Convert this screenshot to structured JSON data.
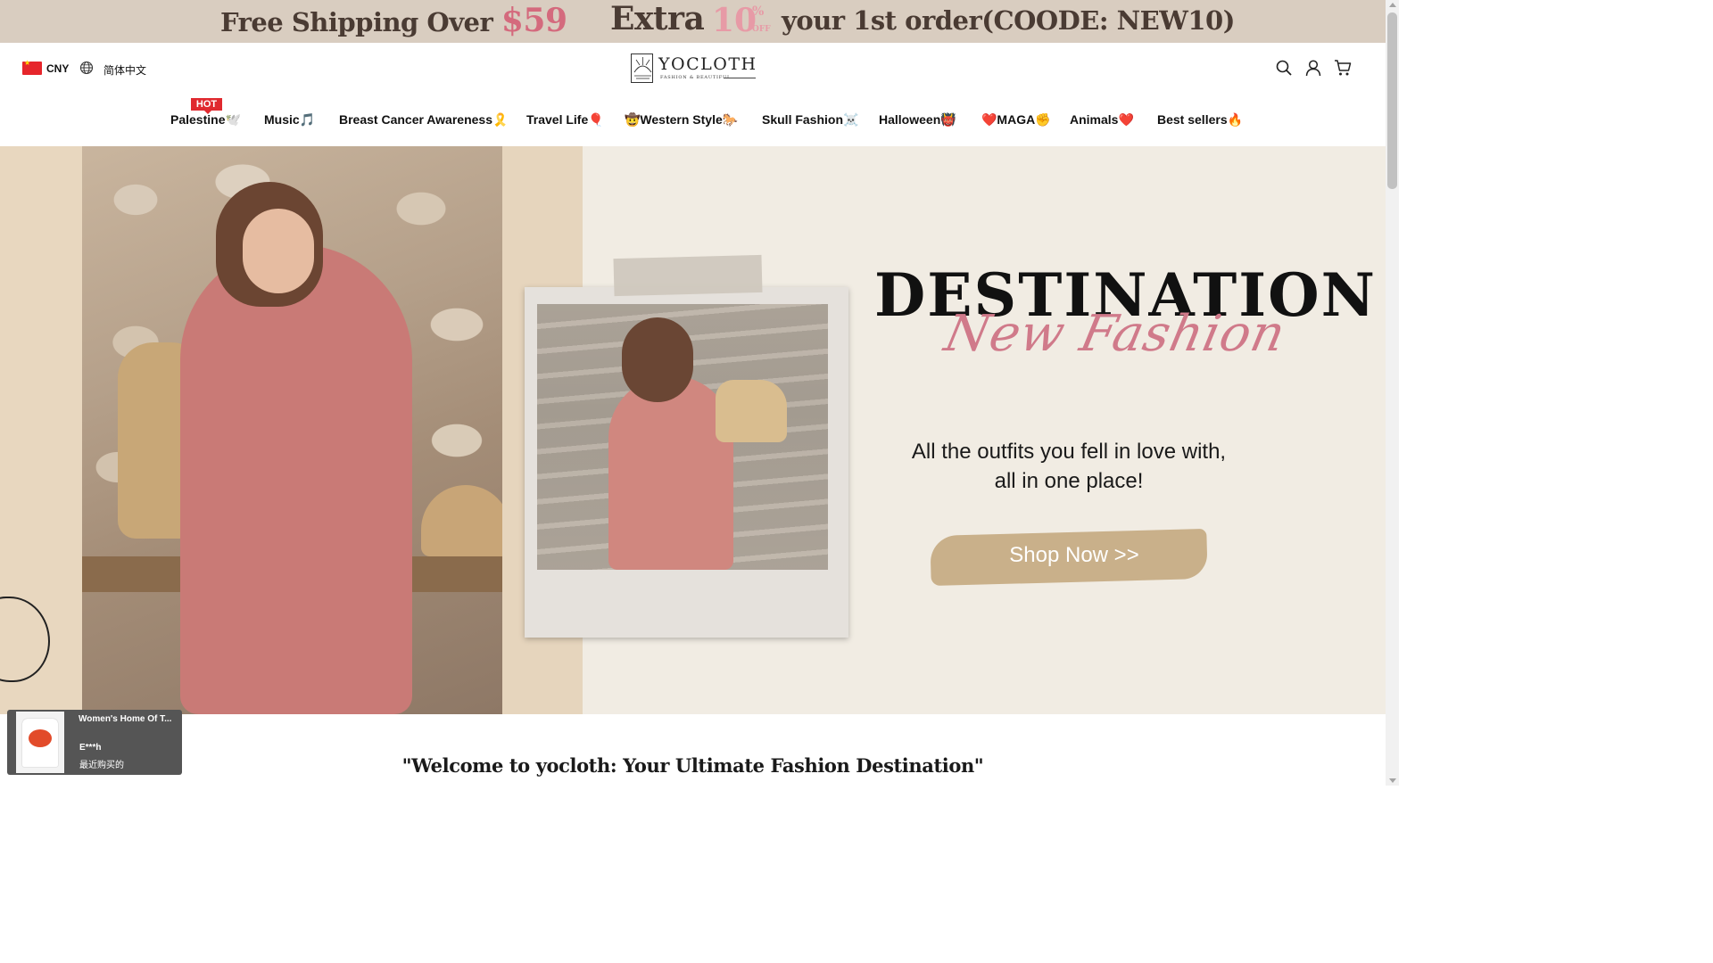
{
  "promo": {
    "shipping_text": "Free Shipping Over ",
    "shipping_amount": "$59",
    "extra_text": "Extra",
    "discount": "10",
    "percent_sign": "%",
    "off_text": "OFF",
    "order_text": "your 1st order(COODE: NEW10)"
  },
  "header": {
    "currency": "CNY",
    "language": "简体中文",
    "logo_name": "YOCLOTH",
    "logo_tagline": "FASHION & BEAUTIFUL"
  },
  "nav": {
    "hot_badge": "HOT",
    "items": [
      {
        "label": "Palestine🕊️"
      },
      {
        "label": "Music🎵"
      },
      {
        "label": "Breast Cancer Awareness🎗️"
      },
      {
        "label": "Travel Life🎈"
      },
      {
        "label": "🤠Western Style🐎"
      },
      {
        "label": "Skull Fashion☠️"
      },
      {
        "label": "Halloween👹"
      },
      {
        "label": "❤️MAGA✊"
      },
      {
        "label": "Animals❤️"
      },
      {
        "label": "Best sellers🔥"
      }
    ]
  },
  "hero": {
    "headline": "DESTINATION",
    "script": "New Fashion",
    "tagline_line1": "All the outfits you fell in love with,",
    "tagline_line2": "all in one place!",
    "cta": "Shop Now >>"
  },
  "welcome": "\"Welcome to yocloth: Your Ultimate Fashion Destination\"",
  "popup": {
    "product": "Women's Home Of T...",
    "user": "E***h",
    "time": "最近购买的"
  },
  "colors": {
    "promo_bg": "#d9cdc0",
    "accent_pink": "#d07a8a",
    "cta_brush": "#c9b08a",
    "hot_red": "#e0292f"
  }
}
